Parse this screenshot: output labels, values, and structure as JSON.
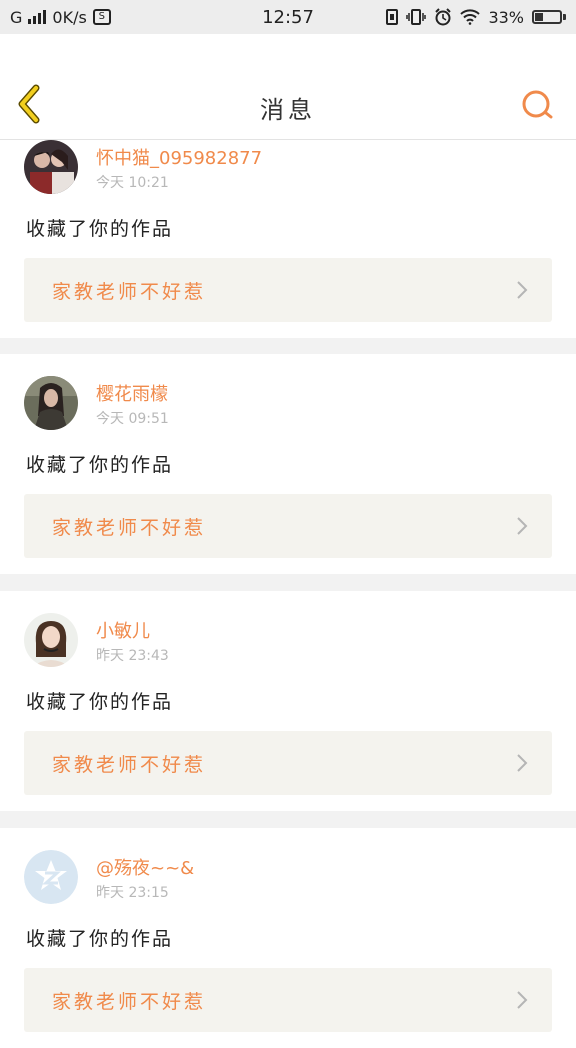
{
  "status_bar": {
    "network": "G",
    "speed": "0K/s",
    "time": "12:57",
    "battery": "33%",
    "icons": [
      "signal-icon",
      "screenshot-icon",
      "sim-icon",
      "vibrate-icon",
      "alarm-icon",
      "wifi-icon",
      "battery-icon"
    ]
  },
  "header": {
    "title": "消息",
    "back_icon": "chevron-left-icon",
    "search_icon": "search-icon",
    "accent": "#f08a4b",
    "back_color": "#f2cf1f"
  },
  "notifications": [
    {
      "user": "怀中猫_095982877",
      "time": "今天 10:21",
      "action": "收藏了你的作品",
      "work": "家教老师不好惹",
      "avatar": "photo-couple"
    },
    {
      "user": "樱花雨檬",
      "time": "今天 09:51",
      "action": "收藏了你的作品",
      "work": "家教老师不好惹",
      "avatar": "photo-girl-dark"
    },
    {
      "user": "小敏儿",
      "time": "昨天 23:43",
      "action": "收藏了你的作品",
      "work": "家教老师不好惹",
      "avatar": "photo-girl-light"
    },
    {
      "user": "@殇夜~~&",
      "time": "昨天 23:15",
      "action": "收藏了你的作品",
      "work": "家教老师不好惹",
      "avatar": "default-qq-avatar"
    }
  ]
}
